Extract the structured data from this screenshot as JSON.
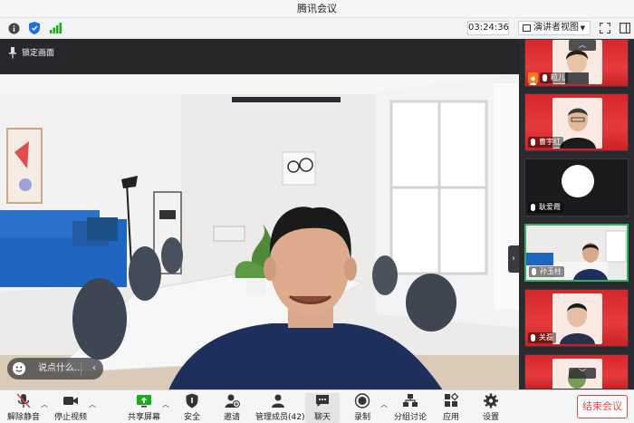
{
  "window": {
    "title": "腾讯会议"
  },
  "statusbar": {
    "timer": "03:24:36",
    "view_label": "演讲者视图",
    "icons": [
      "info-icon",
      "shield-icon",
      "signal-icon",
      "fullscreen-icon",
      "sidebar-toggle-icon"
    ]
  },
  "stage": {
    "pin_label": "锁定画面",
    "chat_placeholder": "说点什么..."
  },
  "participants": [
    {
      "name": "粒儿",
      "type": "red"
    },
    {
      "name": "曹宇红",
      "type": "red"
    },
    {
      "name": "耿爱霞",
      "type": "avatar"
    },
    {
      "name": "孙玉柱",
      "type": "room"
    },
    {
      "name": "关磊",
      "type": "red"
    },
    {
      "name": "",
      "type": "red-partial"
    }
  ],
  "toolbar": {
    "mute": "解除静音",
    "stop_video": "停止视频",
    "share": "共享屏幕",
    "security": "安全",
    "invite": "邀请",
    "members": "管理成员(42)",
    "chat": "聊天",
    "record": "录制",
    "breakout": "分组讨论",
    "apps": "应用",
    "settings": "设置",
    "end": "结束会议"
  },
  "colors": {
    "end_red": "#e84545",
    "brand_blue": "#1f6fe5",
    "active_green": "#1aad19"
  }
}
